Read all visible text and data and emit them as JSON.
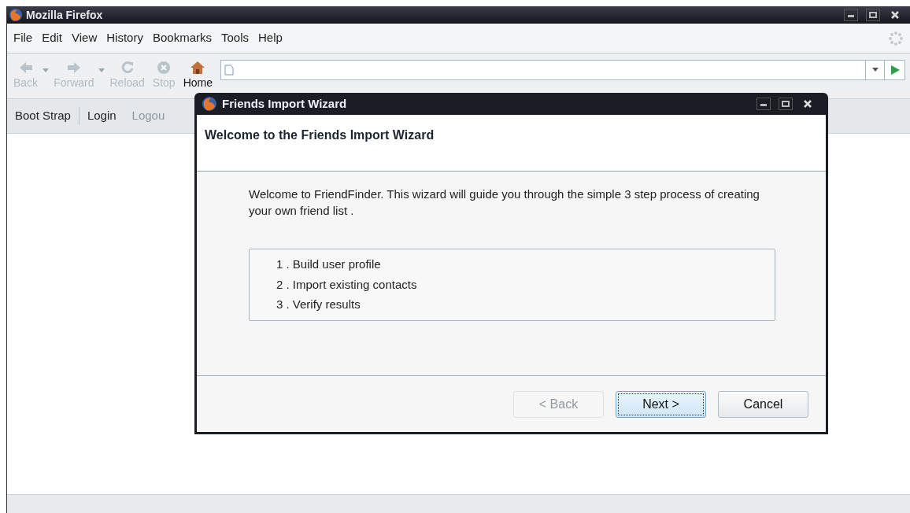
{
  "browser": {
    "title": "Mozilla Firefox",
    "menu": [
      {
        "label": "File"
      },
      {
        "label": "Edit"
      },
      {
        "label": "View"
      },
      {
        "label": "History"
      },
      {
        "label": "Bookmarks"
      },
      {
        "label": "Tools"
      },
      {
        "label": "Help"
      }
    ],
    "nav_buttons": [
      {
        "kind": "back",
        "label": "Back",
        "disabled": true,
        "dropdown": true
      },
      {
        "kind": "forward",
        "label": "Forward",
        "disabled": true,
        "dropdown": true
      },
      {
        "kind": "reload",
        "label": "Reload",
        "disabled": true,
        "dropdown": false
      },
      {
        "kind": "stop",
        "label": "Stop",
        "disabled": true,
        "dropdown": false
      },
      {
        "kind": "home",
        "label": "Home",
        "disabled": false,
        "dropdown": false
      }
    ],
    "bookmarks": [
      {
        "label": "Boot Strap",
        "disabled": false
      },
      {
        "label": "Login",
        "disabled": false
      },
      {
        "label": "Logou",
        "disabled": true
      }
    ]
  },
  "dialog": {
    "title": "Friends Import Wizard",
    "heading": "Welcome to the Friends Import Wizard",
    "intro": "Welcome to FriendFinder. This wizard will guide you through the simple 3 step process of creating your own friend list .",
    "steps": [
      "1 . Build user profile",
      "2 . Import existing contacts",
      "3 . Verify results"
    ],
    "buttons": [
      {
        "label": "< Back",
        "disabled": true,
        "default": false
      },
      {
        "label": "Next >",
        "disabled": false,
        "default": true
      },
      {
        "label": "Cancel",
        "disabled": false,
        "default": false
      }
    ]
  }
}
